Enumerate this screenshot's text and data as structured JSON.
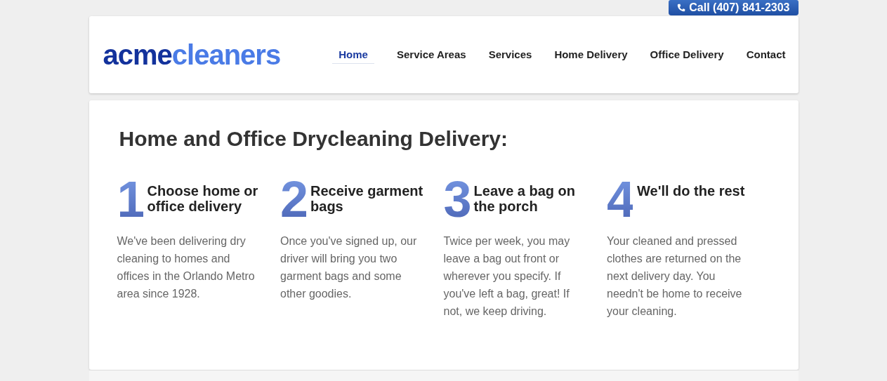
{
  "call_button": "Call (407) 841-2303",
  "logo": {
    "first": "acme",
    "second": "cleaners"
  },
  "nav": [
    {
      "label": "Home",
      "selected": true
    },
    {
      "label": "Service Areas",
      "selected": false
    },
    {
      "label": "Services",
      "selected": false
    },
    {
      "label": "Home Delivery",
      "selected": false
    },
    {
      "label": "Office Delivery",
      "selected": false
    },
    {
      "label": "Contact",
      "selected": false
    }
  ],
  "heading": "Home and Office Drycleaning Delivery:",
  "steps": [
    {
      "number": "1",
      "title": "Choose home or office delivery",
      "text": "We've been delivering dry cleaning to homes and offices in the Orlando Metro area since 1928."
    },
    {
      "number": "2",
      "title": "Receive garment bags",
      "text": "Once you've signed up, our driver will bring you two garment bags and some other goodies."
    },
    {
      "number": "3",
      "title": "Leave a bag on the porch",
      "text": "Twice per week, you may leave a bag out front or wherever you specify. If you've left a bag, great! If not, we keep driving."
    },
    {
      "number": "4",
      "title": "We'll do the rest",
      "text": "Your cleaned and pressed clothes are returned on the next delivery day. You needn't be home to receive your cleaning."
    }
  ]
}
